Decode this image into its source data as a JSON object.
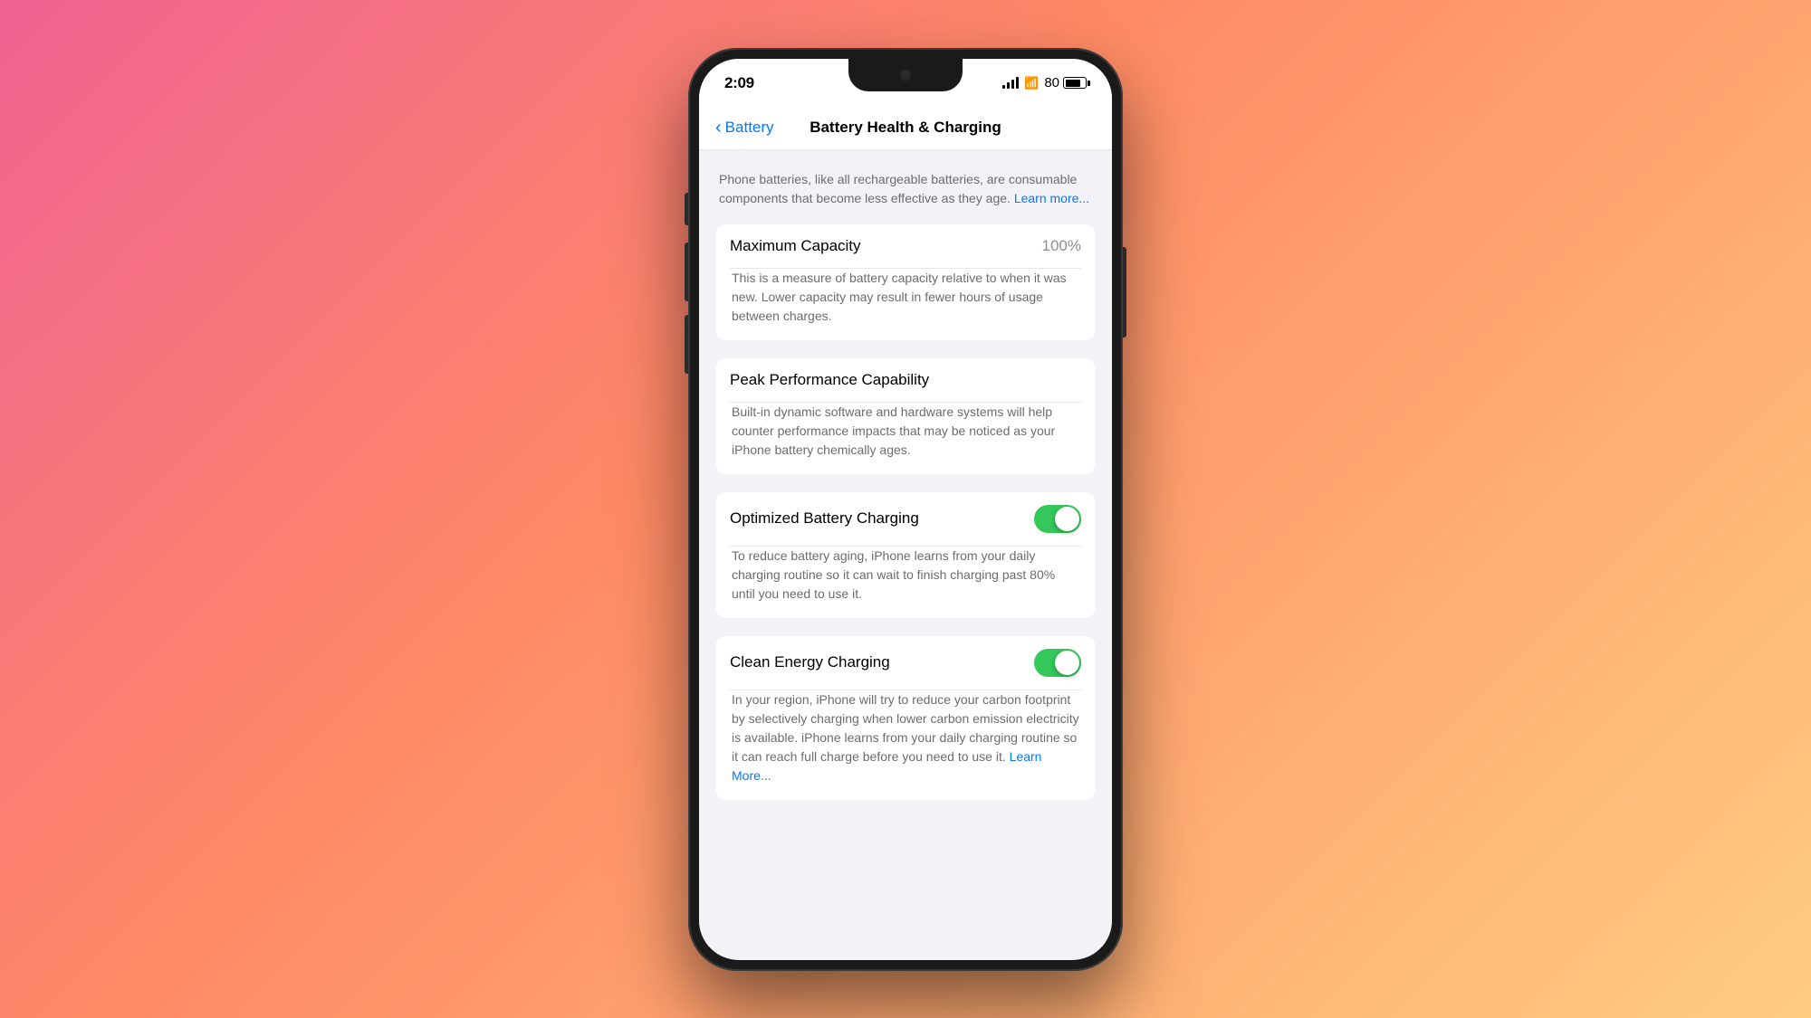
{
  "background": {
    "gradient": "linear-gradient(135deg, #f06292 0%, #ff8a65 40%, #ffcc80 100%)"
  },
  "statusBar": {
    "time": "2:09",
    "batteryPercent": "80",
    "batteryLabel": "80"
  },
  "navBar": {
    "backLabel": "Battery",
    "title": "Battery Health & Charging"
  },
  "content": {
    "description": "Phone batteries, like all rechargeable batteries, are consumable components that become less effective as they age.",
    "learnMoreLabel": "Learn more...",
    "maxCapacity": {
      "label": "Maximum Capacity",
      "value": "100%",
      "description": "This is a measure of battery capacity relative to when it was new. Lower capacity may result in fewer hours of usage between charges."
    },
    "peakPerformance": {
      "label": "Peak Performance Capability",
      "description": "Built-in dynamic software and hardware systems will help counter performance impacts that may be noticed as your iPhone battery chemically ages."
    },
    "optimizedCharging": {
      "label": "Optimized Battery Charging",
      "enabled": true,
      "description": "To reduce battery aging, iPhone learns from your daily charging routine so it can wait to finish charging past 80% until you need to use it."
    },
    "cleanEnergy": {
      "label": "Clean Energy Charging",
      "enabled": true,
      "description": "In your region, iPhone will try to reduce your carbon footprint by selectively charging when lower carbon emission electricity is available. iPhone learns from your daily charging routine so it can reach full charge before you need to use it.",
      "learnMoreLabel": "Learn More..."
    }
  }
}
